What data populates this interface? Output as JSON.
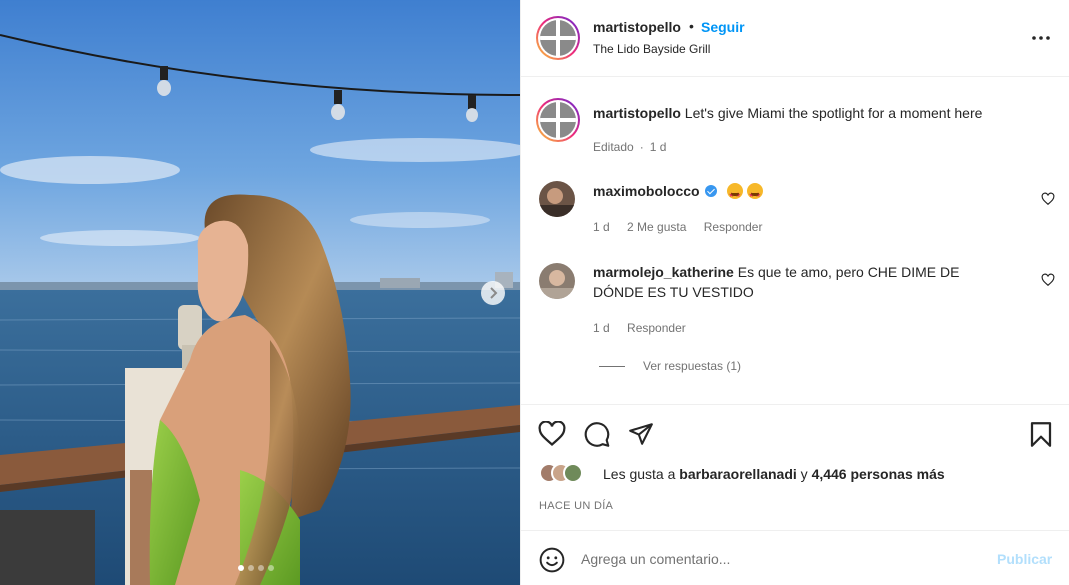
{
  "post": {
    "author": "martistopello",
    "separator": "•",
    "follow_label": "Seguir",
    "location": "The Lido Bayside Grill",
    "carousel": {
      "slides": 4,
      "active_slide": 1
    }
  },
  "caption": {
    "username": "martistopello",
    "text": "Let's give Miami the spotlight for a moment here",
    "edited": "Editado",
    "time": "1 d"
  },
  "comments": [
    {
      "username": "maximobolocco",
      "verified": true,
      "text": "",
      "emojis": [
        "star-struck",
        "star-struck"
      ],
      "time": "1 d",
      "likes": "2 Me gusta",
      "reply": "Responder"
    },
    {
      "username": "marmolejo_katherine",
      "verified": false,
      "text": "Es que te amo, pero CHE DIME DE DÓNDE ES TU VESTIDO",
      "time": "1 d",
      "reply": "Responder",
      "view_replies": "Ver respuestas (1)"
    }
  ],
  "likes": {
    "prefix": "Les gusta a",
    "user": "barbaraorellanadi",
    "connector": "y",
    "others": "4,446 personas más"
  },
  "date": "HACE UN DÍA",
  "composer": {
    "placeholder": "Agrega un comentario...",
    "publish_label": "Publicar"
  },
  "colors": {
    "link_blue": "#0095f6",
    "publish_disabled": "#b2dffc",
    "muted": "#737373",
    "text": "#262626"
  },
  "icons": [
    "more-options-icon",
    "heart-icon",
    "comment-icon",
    "share-icon",
    "bookmark-icon",
    "emoji-icon",
    "next-slide-icon",
    "verified-icon"
  ]
}
